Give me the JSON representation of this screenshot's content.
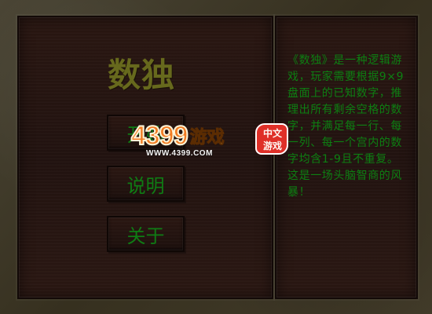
{
  "game": {
    "title": "数独",
    "menu": {
      "start_label": "开始",
      "help_label": "说明",
      "about_label": "关于"
    },
    "description": "《数独》是一种逻辑游戏，玩家需要根据9×9盘面上的已知数字，推理出所有剩余空格的数字，并满足每一行、每一列、每一个宫内的数字均含1-9且不重复。这是一场头脑智商的风暴！"
  },
  "watermark": {
    "brand_number": "4399",
    "brand_text": "游戏",
    "url": "WWW.4399.COM",
    "seal_line_1": "中文",
    "seal_line_2": "游戏"
  },
  "colors": {
    "title": "#67691d",
    "menu_text": "#0f7c14",
    "description_text": "#0d7f12",
    "logo_orange": "#f27b22",
    "logo_yellow": "#ffd36a",
    "seal_red": "#df2f28"
  }
}
